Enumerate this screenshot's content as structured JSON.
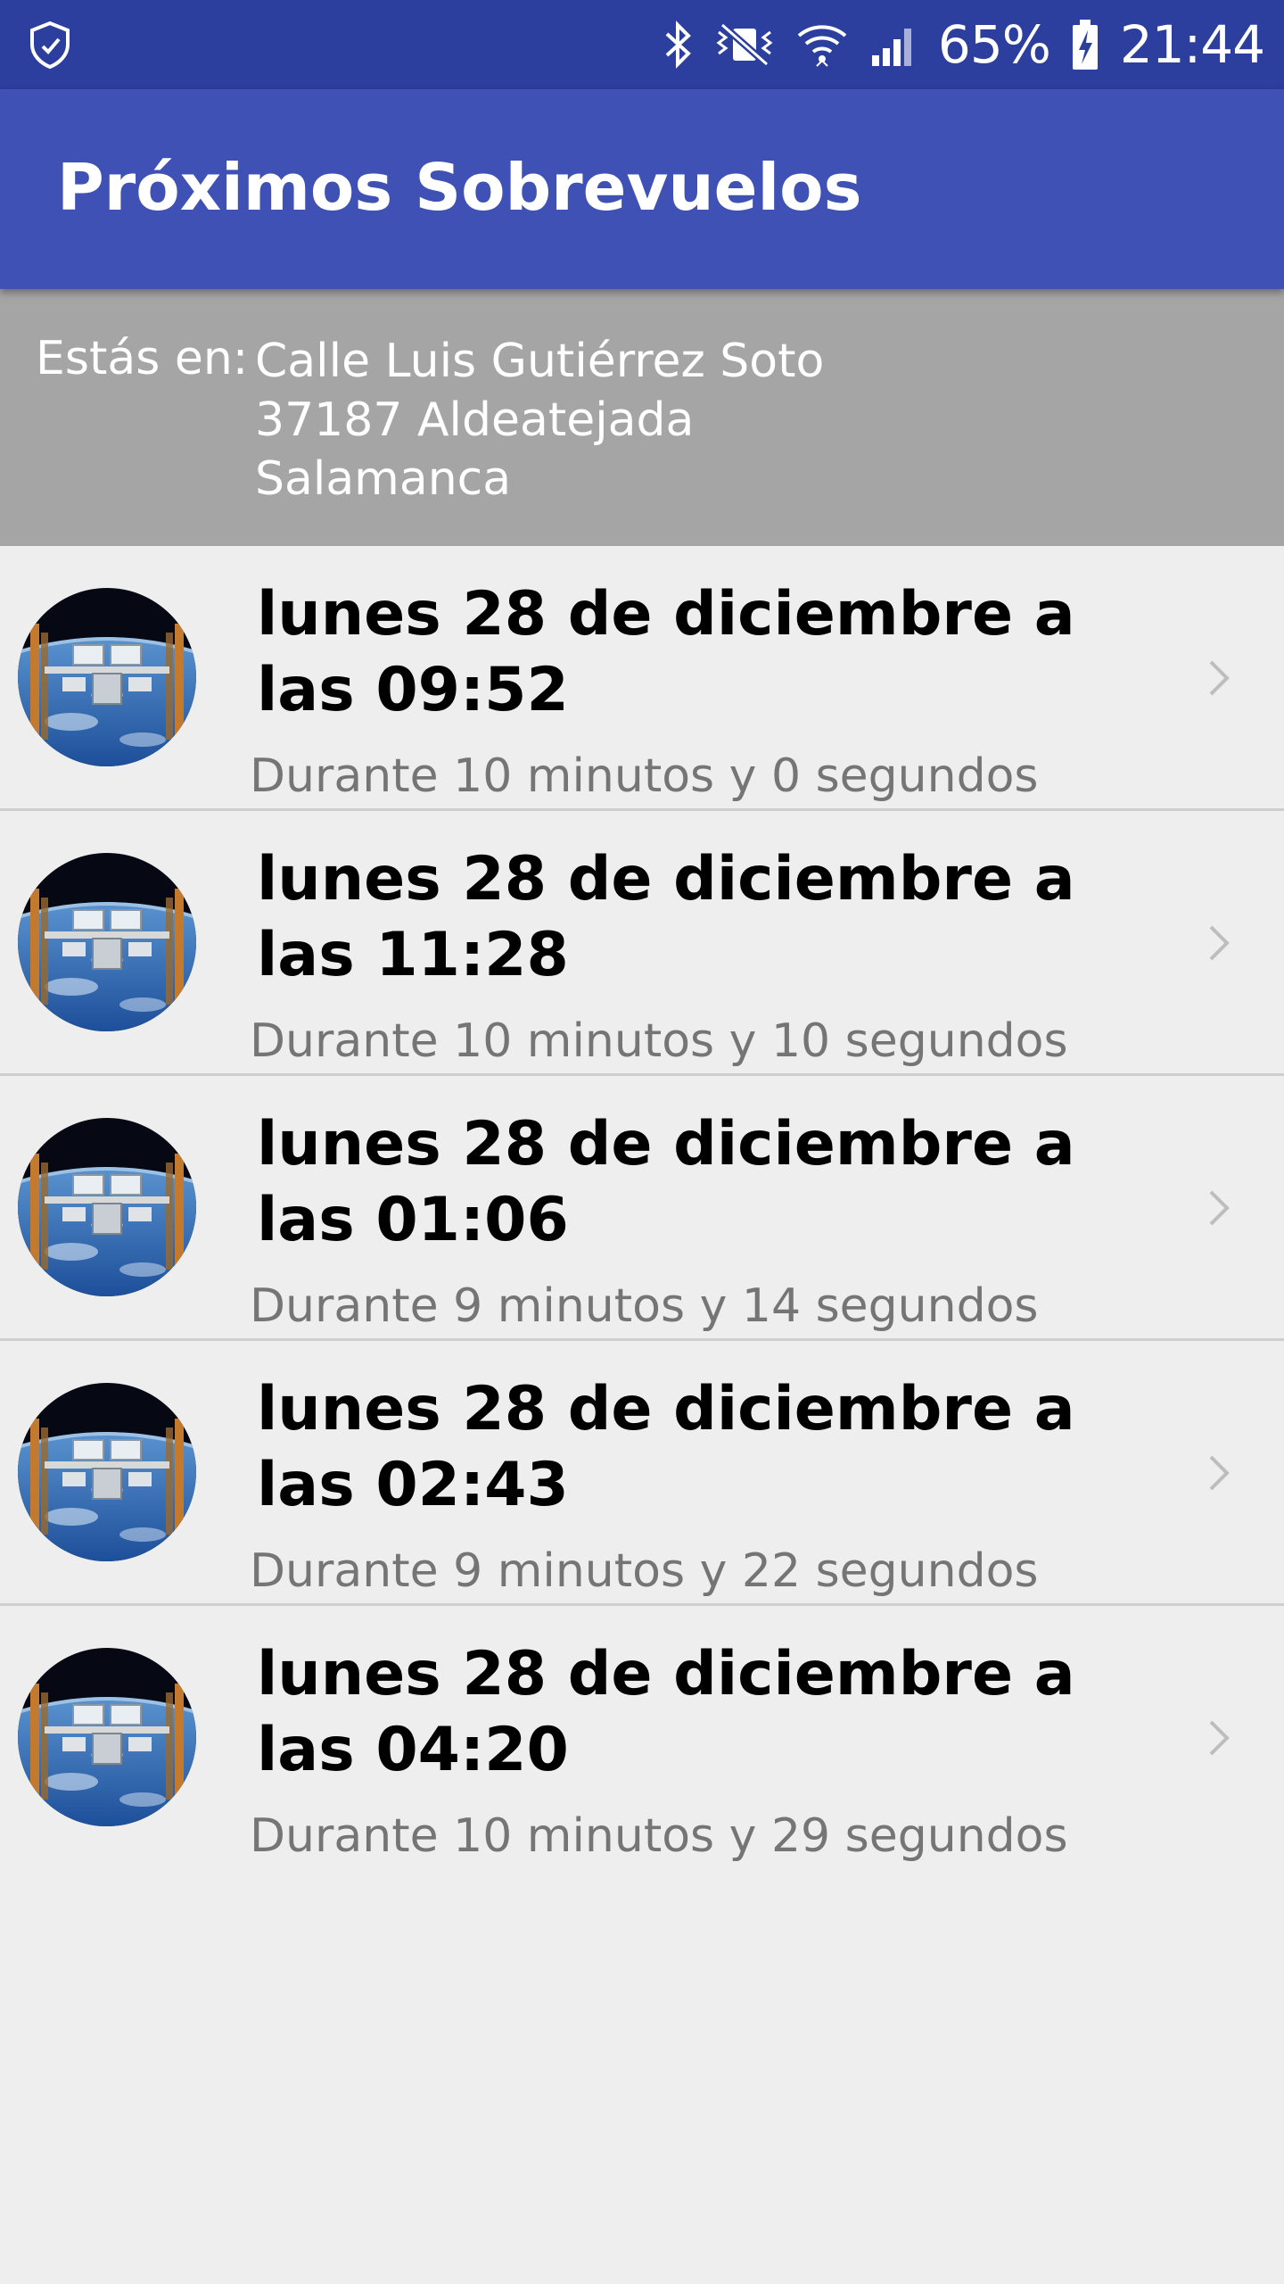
{
  "status_bar": {
    "battery": "65%",
    "time": "21:44",
    "icons": [
      "shield-notification-icon",
      "bluetooth-icon",
      "mute-vibrate-icon",
      "wifi-icon",
      "cellular-signal-icon",
      "battery-charging-icon"
    ]
  },
  "app_bar": {
    "title": "Próximos Sobrevuelos",
    "color": "#3f51b5"
  },
  "location": {
    "label": "Estás en:",
    "street": "Calle Luis Gutiérrez Soto",
    "city": "37187 Aldeatejada",
    "province": "Salamanca"
  },
  "passes": [
    {
      "title": "lunes 28 de diciembre a las 09:52",
      "duration": "Durante 10 minutos y 0 segundos",
      "thumbnail": "iss-thumbnail"
    },
    {
      "title": "lunes 28 de diciembre a las 11:28",
      "duration": "Durante 10 minutos y 10 segundos",
      "thumbnail": "iss-thumbnail"
    },
    {
      "title": "lunes 28 de diciembre a las 01:06",
      "duration": "Durante 9 minutos y 14 segundos",
      "thumbnail": "iss-thumbnail"
    },
    {
      "title": "lunes 28 de diciembre a las 02:43",
      "duration": "Durante 9 minutos y 22 segundos",
      "thumbnail": "iss-thumbnail"
    },
    {
      "title": "lunes 28 de diciembre a las 04:20",
      "duration": "Durante 10 minutos y 29 segundos",
      "thumbnail": "iss-thumbnail"
    }
  ]
}
